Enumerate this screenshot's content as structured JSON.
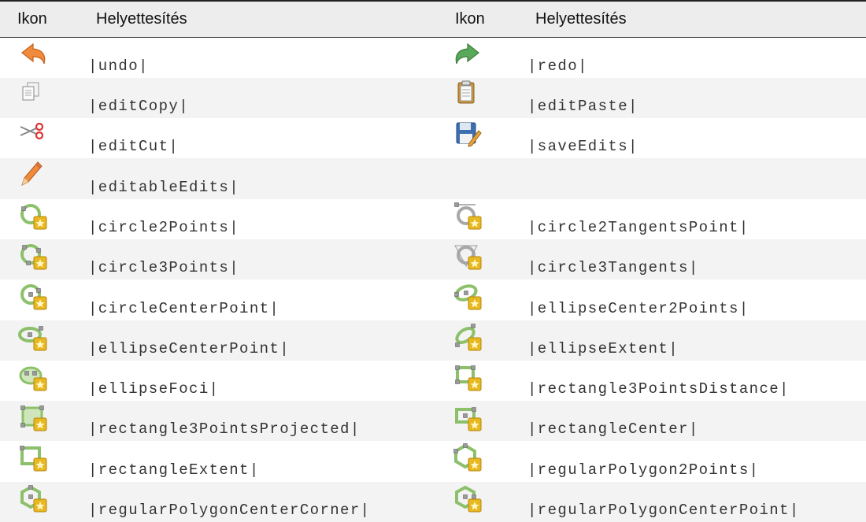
{
  "table": {
    "headers": {
      "icon_col_1": "Ikon",
      "sub_col_1": "Helyettesítés",
      "icon_col_2": "Ikon",
      "sub_col_2": "Helyettesítés"
    },
    "rows": [
      {
        "left": {
          "icon": "undo-icon",
          "text": "|undo|"
        },
        "right": {
          "icon": "redo-icon",
          "text": "|redo|"
        }
      },
      {
        "left": {
          "icon": "edit-copy-icon",
          "text": "|editCopy|"
        },
        "right": {
          "icon": "edit-paste-icon",
          "text": "|editPaste|"
        }
      },
      {
        "left": {
          "icon": "edit-cut-icon",
          "text": "|editCut|"
        },
        "right": {
          "icon": "save-edits-icon",
          "text": "|saveEdits|"
        }
      },
      {
        "left": {
          "icon": "editable-edits-icon",
          "text": "|editableEdits|"
        },
        "right": {
          "icon": "",
          "text": ""
        }
      },
      {
        "left": {
          "icon": "circle-2-points-icon",
          "text": "|circle2Points|"
        },
        "right": {
          "icon": "circle-2-tangents-point-icon",
          "text": "|circle2TangentsPoint|"
        }
      },
      {
        "left": {
          "icon": "circle-3-points-icon",
          "text": "|circle3Points|"
        },
        "right": {
          "icon": "circle-3-tangents-icon",
          "text": "|circle3Tangents|"
        }
      },
      {
        "left": {
          "icon": "circle-center-point-icon",
          "text": "|circleCenterPoint|"
        },
        "right": {
          "icon": "ellipse-center-2-points-icon",
          "text": "|ellipseCenter2Points|"
        }
      },
      {
        "left": {
          "icon": "ellipse-center-point-icon",
          "text": "|ellipseCenterPoint|"
        },
        "right": {
          "icon": "ellipse-extent-icon",
          "text": "|ellipseExtent|"
        }
      },
      {
        "left": {
          "icon": "ellipse-foci-icon",
          "text": "|ellipseFoci|"
        },
        "right": {
          "icon": "rectangle-3-points-distance-icon",
          "text": "|rectangle3PointsDistance|"
        }
      },
      {
        "left": {
          "icon": "rectangle-3-points-projected-icon",
          "text": "|rectangle3PointsProjected|"
        },
        "right": {
          "icon": "rectangle-center-icon",
          "text": "|rectangleCenter|"
        }
      },
      {
        "left": {
          "icon": "rectangle-extent-icon",
          "text": "|rectangleExtent|"
        },
        "right": {
          "icon": "regular-polygon-2-points-icon",
          "text": "|regularPolygon2Points|"
        }
      },
      {
        "left": {
          "icon": "regular-polygon-center-corner-icon",
          "text": "|regularPolygonCenterCorner|"
        },
        "right": {
          "icon": "regular-polygon-center-point-icon",
          "text": "|regularPolygonCenterPoint|"
        }
      }
    ]
  },
  "colors": {
    "header_bg": "#ededed",
    "row_alt_bg": "#f3f3f3",
    "shape_green": "#8cc06a",
    "badge_yellow": "#e8b820",
    "undo_orange": "#f08a3c",
    "redo_green": "#5aa85a"
  }
}
